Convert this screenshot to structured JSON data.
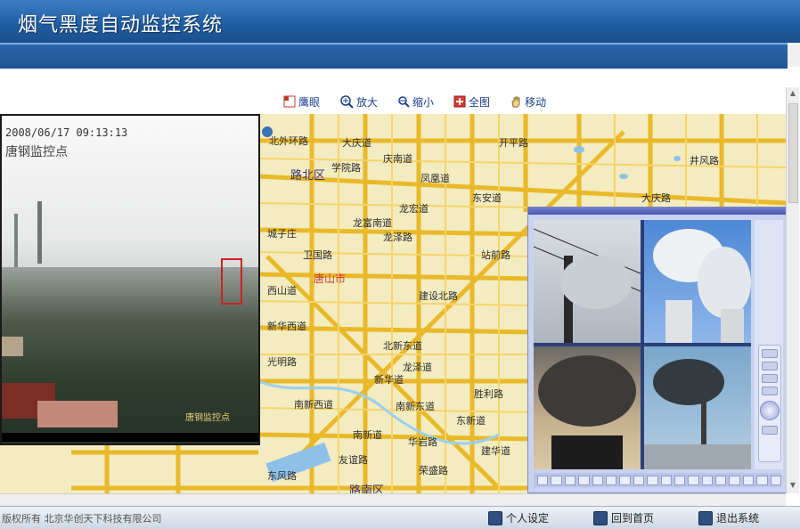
{
  "app": {
    "title": "烟气黑度自动监控系统"
  },
  "toolbar": {
    "items": [
      {
        "label": "鹰眼",
        "icon": "eagle-eye-icon"
      },
      {
        "label": "放大",
        "icon": "zoom-in-icon"
      },
      {
        "label": "缩小",
        "icon": "zoom-out-icon"
      },
      {
        "label": "全图",
        "icon": "full-map-icon"
      },
      {
        "label": "移动",
        "icon": "pan-hand-icon"
      }
    ]
  },
  "map": {
    "labels": [
      "北外环路",
      "大庆道",
      "庆南道",
      "路北区",
      "学院路",
      "凤凰道",
      "龙富南道",
      "龙宏道",
      "龙泽路",
      "东安道",
      "唐山市",
      "新华西道",
      "新华道",
      "卫国路",
      "城子庄",
      "南新西道",
      "南新东道",
      "北新东道",
      "建设北路",
      "站前路",
      "光明路",
      "胜利路",
      "东新道",
      "龙泽道",
      "南新道",
      "西山道",
      "华岩路",
      "开平路",
      "井风路",
      "大庆路",
      "友谊路",
      "东风路",
      "建华道",
      "荣盛路",
      "路南区"
    ]
  },
  "camera": {
    "timestamp": "2008/06/17  09:13:13",
    "site": "唐钢监控点",
    "caption": "唐钢监控点"
  },
  "footer": {
    "copyright": "版权所有 北京华创天下科技有限公司",
    "buttons": [
      {
        "label": "个人设定",
        "icon": "user-settings-icon"
      },
      {
        "label": "回到首页",
        "icon": "home-icon"
      },
      {
        "label": "退出系统",
        "icon": "exit-icon"
      }
    ]
  }
}
